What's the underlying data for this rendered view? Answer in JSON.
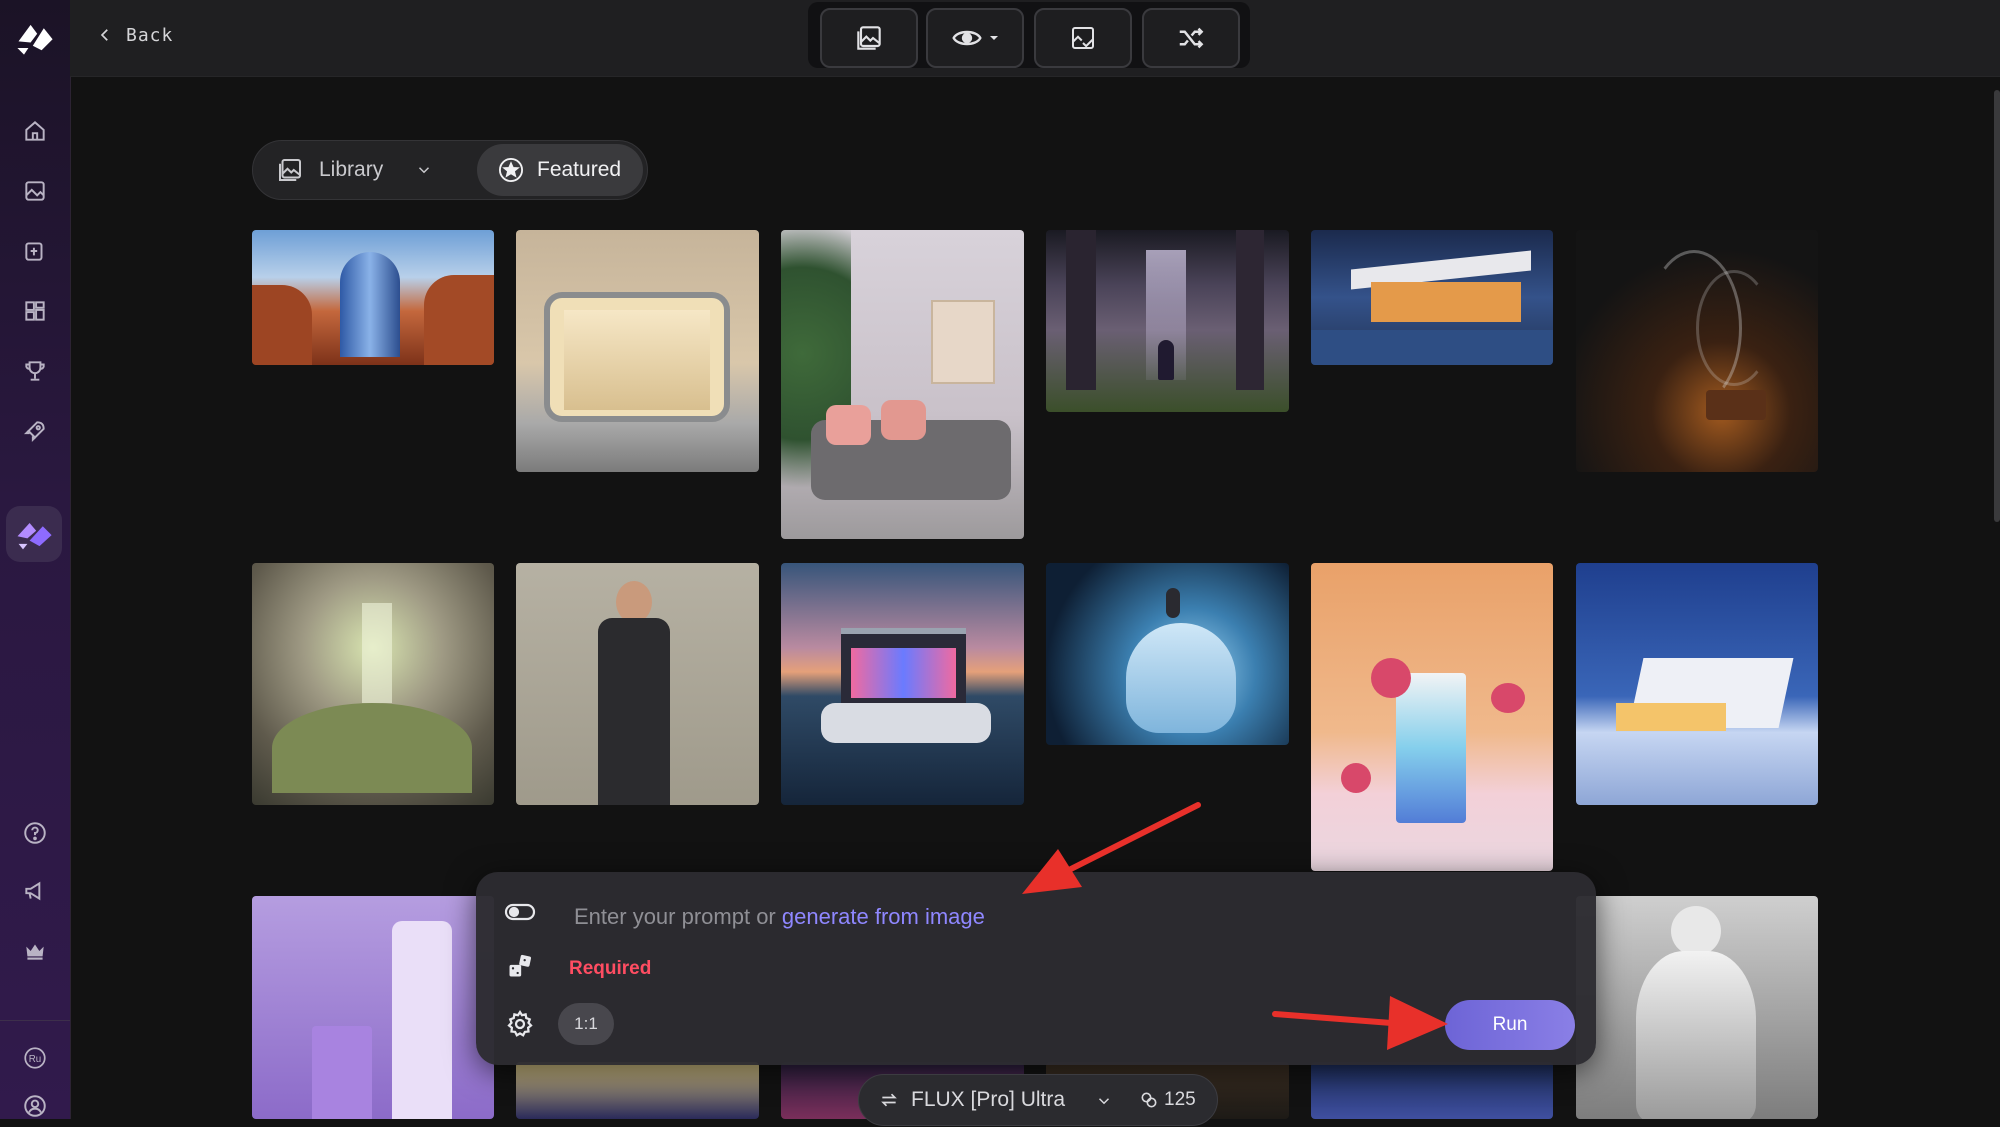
{
  "topbar": {
    "back_label": "Back",
    "tools": [
      {
        "icon": "gallery-icon"
      },
      {
        "icon": "eye-icon"
      },
      {
        "icon": "image-check-icon"
      },
      {
        "icon": "shuffle-icon"
      }
    ]
  },
  "sidebar": {
    "items": [
      {
        "icon": "home-icon"
      },
      {
        "icon": "image-icon"
      },
      {
        "icon": "upload-icon"
      },
      {
        "icon": "grid-icon"
      },
      {
        "icon": "trophy-icon"
      },
      {
        "icon": "rocket-icon"
      },
      {
        "icon": "app-logo-icon"
      },
      {
        "icon": "help-icon"
      },
      {
        "icon": "megaphone-icon"
      },
      {
        "icon": "crown-icon"
      },
      {
        "icon": "avatar-icon",
        "text": "Ru"
      },
      {
        "icon": "user-icon"
      }
    ]
  },
  "gallery": {
    "tabs": {
      "library": "Library",
      "featured": "Featured"
    }
  },
  "prompt": {
    "placeholder": "Enter your prompt or ",
    "link": "generate from image",
    "required": "Required",
    "ratio": "1:1",
    "run_label": "Run"
  },
  "model": {
    "name": "FLUX [Pro] Ultra",
    "credits": "125"
  },
  "colors": {
    "accent": "#8f87ff",
    "run_button": "#7a70de",
    "required": "#ff4d62",
    "annotation_arrow": "#e8302a"
  }
}
